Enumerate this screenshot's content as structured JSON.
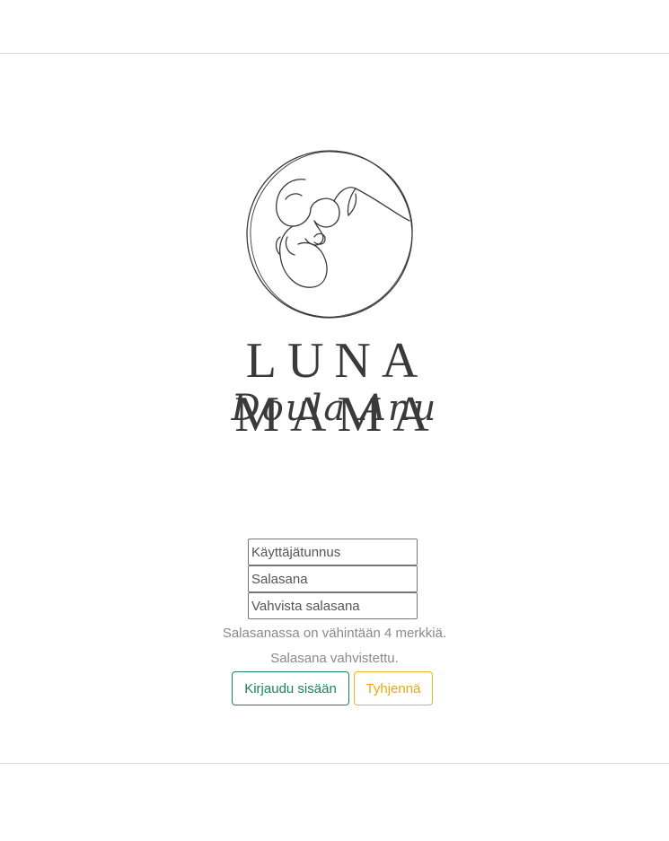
{
  "brand": {
    "name": "LUNA MAMA",
    "subtitle": "Doula Anu",
    "logo_icon": "fetus-in-circle-line-art-icon"
  },
  "form": {
    "username_placeholder": "Käyttäjätunnus",
    "password_placeholder": "Salasana",
    "confirm_placeholder": "Vahvista salasana",
    "password_length_message": "Salasanassa on vähintään 4 merkkiä.",
    "password_confirmed_message": "Salasana vahvistettu.",
    "login_label": "Kirjaudu sisään",
    "clear_label": "Tyhjennä"
  },
  "colors": {
    "login_button": "#198754",
    "clear_button": "#f2b320",
    "message_text": "#8a8a8a"
  }
}
